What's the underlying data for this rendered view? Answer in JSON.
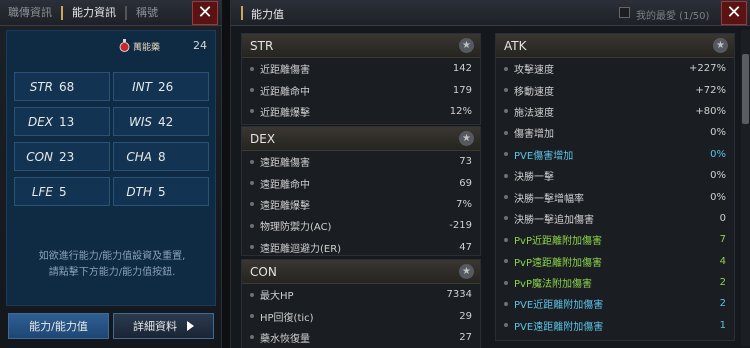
{
  "left_panel": {
    "tabs": [
      {
        "label": "職傳資訊"
      },
      {
        "label": "能力資訊"
      },
      {
        "label": "稱號"
      }
    ],
    "close_glyph": "✕",
    "elixir": {
      "label": "萬能藥",
      "value": "24"
    },
    "stats": [
      {
        "name": "STR",
        "value": "68"
      },
      {
        "name": "INT",
        "value": "26"
      },
      {
        "name": "DEX",
        "value": "13"
      },
      {
        "name": "WIS",
        "value": "42"
      },
      {
        "name": "CON",
        "value": "23"
      },
      {
        "name": "CHA",
        "value": "8"
      },
      {
        "name": "LFE",
        "value": "5"
      },
      {
        "name": "DTH",
        "value": "5"
      }
    ],
    "hint_line1": "如欲進行能力/能力值設資及重置,",
    "hint_line2": "請點擊下方能力/能力值按鈕.",
    "ability_button": "能力/能力值",
    "detail_button": "詳細資料"
  },
  "right_panel": {
    "title": "能力值",
    "favorites_label": "我的最愛 (1/50)",
    "star_glyph": "★",
    "sections": {
      "str": {
        "title": "STR",
        "rows": [
          {
            "label": "近距離傷害",
            "value": "142"
          },
          {
            "label": "近距離命中",
            "value": "179"
          },
          {
            "label": "近距離爆擊",
            "value": "12%"
          }
        ]
      },
      "dex": {
        "title": "DEX",
        "rows": [
          {
            "label": "遠距離傷害",
            "value": "73"
          },
          {
            "label": "遠距離命中",
            "value": "69"
          },
          {
            "label": "遠距離爆擊",
            "value": "7%"
          },
          {
            "label": "物理防禦力(AC)",
            "value": "-219"
          },
          {
            "label": "遠距離迴避力(ER)",
            "value": "47"
          }
        ]
      },
      "con": {
        "title": "CON",
        "rows": [
          {
            "label": "最大HP",
            "value": "7334"
          },
          {
            "label": "HP回復(tic)",
            "value": "29"
          },
          {
            "label": "藥水恢復量",
            "value": "27"
          }
        ]
      },
      "atk": {
        "title": "ATK",
        "rows": [
          {
            "label": "攻擊速度",
            "value": "+227%",
            "color": "normal"
          },
          {
            "label": "移動速度",
            "value": "+72%",
            "color": "normal"
          },
          {
            "label": "施法速度",
            "value": "+80%",
            "color": "normal"
          },
          {
            "label": "傷害增加",
            "value": "0%",
            "color": "normal"
          },
          {
            "label": "PVE傷害增加",
            "value": "0%",
            "color": "cyan"
          },
          {
            "label": "決勝一擊",
            "value": "0%",
            "color": "normal"
          },
          {
            "label": "決勝一擊增幅率",
            "value": "0%",
            "color": "normal"
          },
          {
            "label": "決勝一擊追加傷害",
            "value": "0",
            "color": "normal"
          },
          {
            "label": "PvP近距離附加傷害",
            "value": "7",
            "color": "green"
          },
          {
            "label": "PvP遠距離附加傷害",
            "value": "4",
            "color": "green"
          },
          {
            "label": "PvP魔法附加傷害",
            "value": "2",
            "color": "green"
          },
          {
            "label": "PVE近距離附加傷害",
            "value": "2",
            "color": "cyan"
          },
          {
            "label": "PVE遠距離附加傷害",
            "value": "1",
            "color": "cyan"
          }
        ]
      }
    }
  }
}
